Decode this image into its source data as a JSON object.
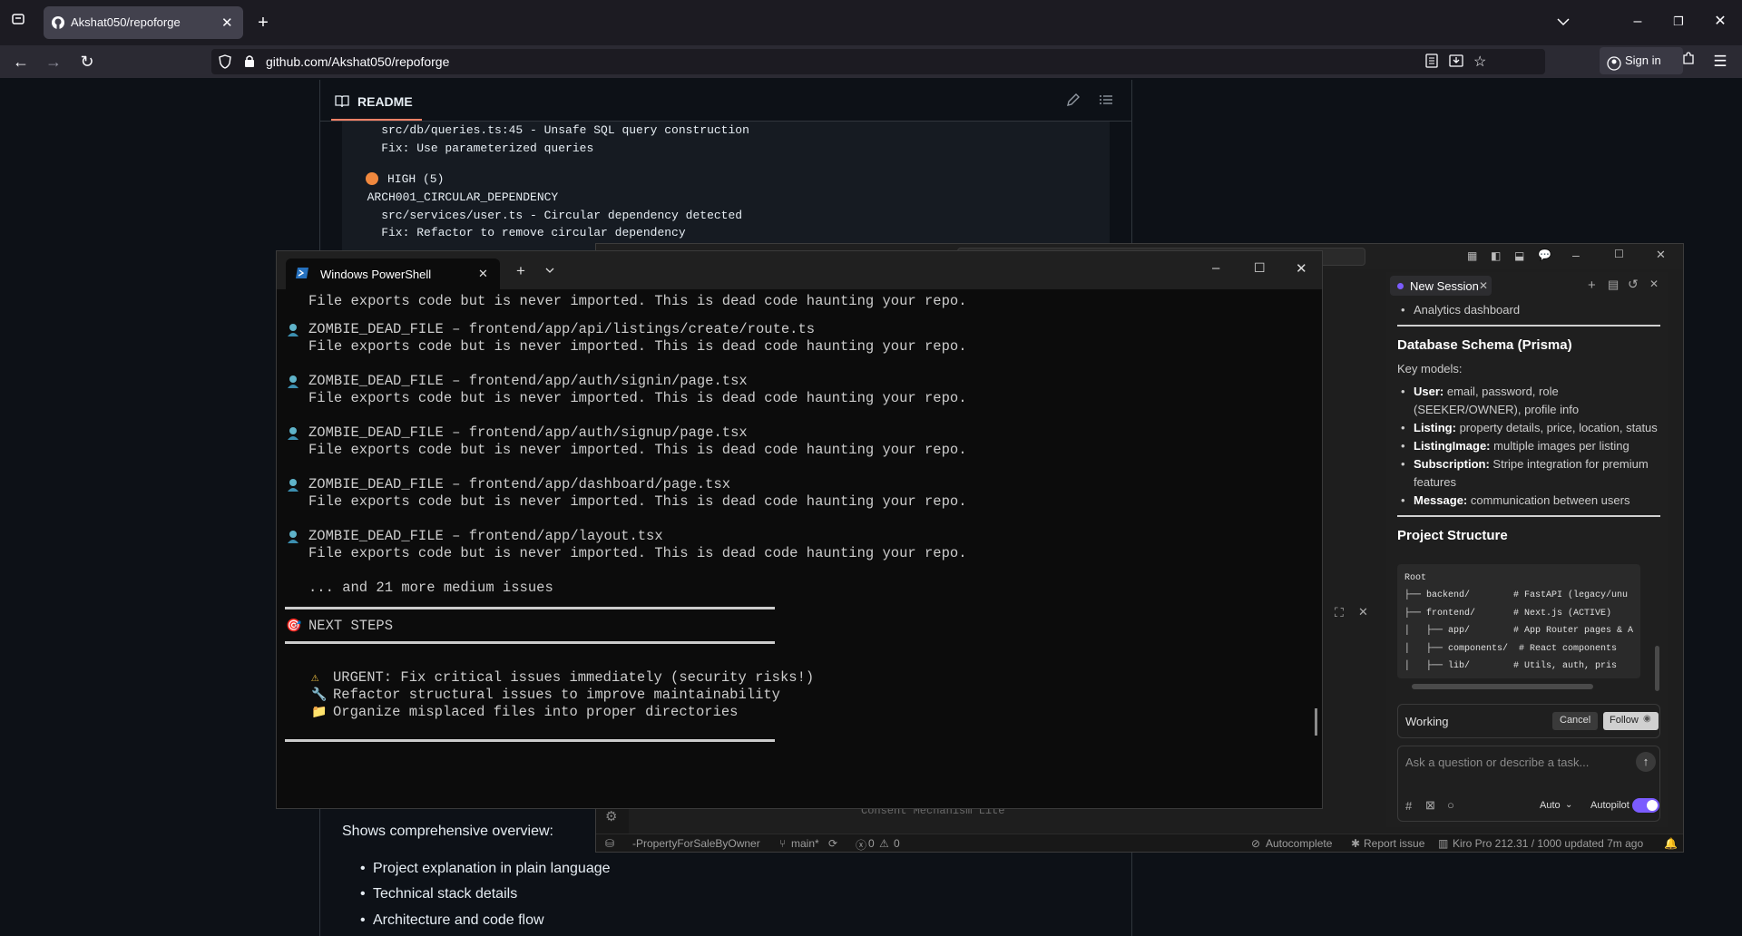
{
  "browser": {
    "tab_title": "Akshat050/repoforge",
    "url": "github.com/Akshat050/repoforge",
    "signin_label": "Sign in"
  },
  "readme": {
    "header_label": "README",
    "code_lines": [
      "    src/db/queries.ts:45 - Unsafe SQL query construction",
      "    Fix: Use parameterized queries",
      "",
      "HIGH (5)",
      "  ARCH001_CIRCULAR_DEPENDENCY",
      "    src/services/user.ts - Circular dependency detected",
      "    Fix: Refactor to remove circular dependency"
    ],
    "overview_text": "Shows comprehensive overview:",
    "overview_items": [
      "Project explanation in plain language",
      "Technical stack details",
      "Architecture and code flow"
    ],
    "status_colors": {
      "high": "#f0883e"
    }
  },
  "powershell": {
    "title": "Windows PowerShell",
    "lines": {
      "l0": "File exports code but is never imported. This is dead code haunting your repo.",
      "l1": "ZOMBIE_DEAD_FILE – frontend/app/api/listings/create/route.ts",
      "l2": "File exports code but is never imported. This is dead code haunting your repo.",
      "l3": "ZOMBIE_DEAD_FILE – frontend/app/auth/signin/page.tsx",
      "l4": "File exports code but is never imported. This is dead code haunting your repo.",
      "l5": "ZOMBIE_DEAD_FILE – frontend/app/auth/signup/page.tsx",
      "l6": "File exports code but is never imported. This is dead code haunting your repo.",
      "l7": "ZOMBIE_DEAD_FILE – frontend/app/dashboard/page.tsx",
      "l8": "File exports code but is never imported. This is dead code haunting your repo.",
      "l9": "ZOMBIE_DEAD_FILE – frontend/app/layout.tsx",
      "l10": "File exports code but is never imported. This is dead code haunting your repo.",
      "l11": "... and 21 more medium issues",
      "next": "NEXT STEPS",
      "urgent": "URGENT: Fix critical issues immediately (security risks!)",
      "refactor": "Refactor structural issues to improve maintainability",
      "organize": "Organize misplaced files into proper directories"
    }
  },
  "kiro": {
    "status": {
      "branch_repo": "-PropertyForSaleByOwner",
      "branch": "main*",
      "problems": "0",
      "warnings": "0",
      "autocomplete": "Autocomplete",
      "report": "Report issue",
      "plan": "Kiro Pro 212.31 / 1000 updated 7m ago"
    },
    "behind_text": "Consent Mechanism Lite"
  },
  "chat": {
    "tab_label": "New Session",
    "top_bullet": "Analytics dashboard",
    "schema_title": "Database Schema (Prisma)",
    "key_models": "Key models:",
    "models": [
      {
        "name": "User:",
        "desc": "email, password, role (SEEKER/OWNER), profile info"
      },
      {
        "name": "Listing:",
        "desc": "property details, price, location, status"
      },
      {
        "name": "ListingImage:",
        "desc": "multiple images per listing"
      },
      {
        "name": "Subscription:",
        "desc": "Stripe integration for premium features"
      },
      {
        "name": "Message:",
        "desc": "communication between users"
      }
    ],
    "structure_title": "Project Structure",
    "tree": {
      "t0": "Root",
      "t1": "├── backend/        # FastAPI (legacy/unu",
      "t2": "├── frontend/       # Next.js (ACTIVE)",
      "t3": "│   ├── app/        # App Router pages & A",
      "t4": "│   ├── components/  # React components",
      "t5": "│   ├── lib/        # Utils, auth, pris"
    },
    "working_label": "Working",
    "cancel_label": "Cancel",
    "follow_label": "Follow",
    "ask_placeholder": "Ask a question or describe a task...",
    "auto_label": "Auto",
    "autopilot_label": "Autopilot",
    "autopilot_on": true,
    "accent": "#7b5cff"
  }
}
